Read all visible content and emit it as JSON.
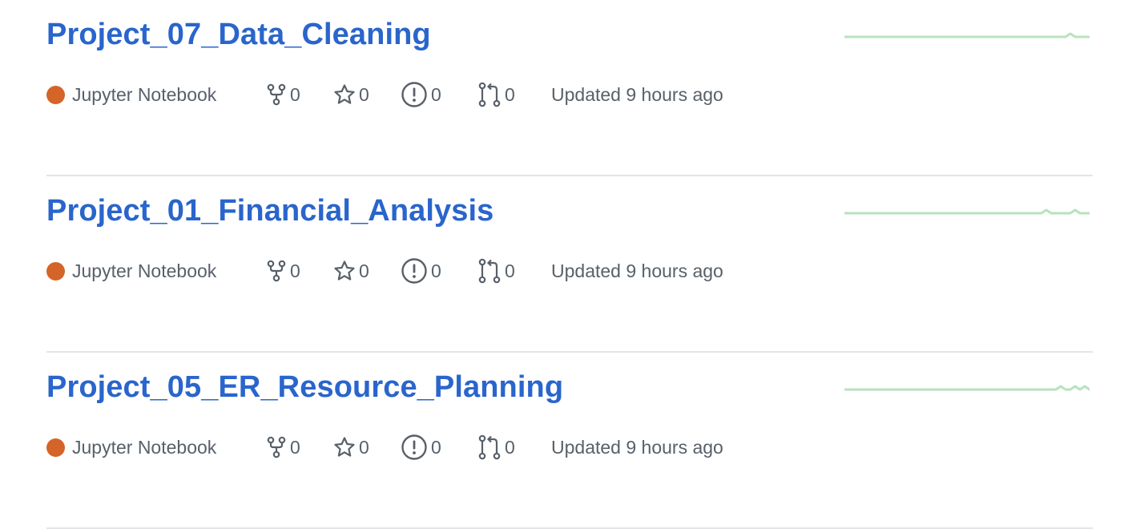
{
  "colors": {
    "title": "#2965cc",
    "meta_text": "#586069",
    "divider": "#e1e4e8",
    "sparkline": "#b7e3bd"
  },
  "repos": [
    {
      "name": "Project_07_Data_Cleaning",
      "language": "Jupyter Notebook",
      "language_color": "#d46428",
      "forks": "0",
      "stars": "0",
      "issues": "0",
      "pull_requests": "0",
      "updated": "Updated 9 hours ago",
      "activity": [
        0,
        0,
        0,
        0,
        0,
        0,
        0,
        0,
        0,
        0,
        0,
        0,
        0,
        0,
        0,
        0,
        0,
        0,
        0,
        0,
        0,
        0,
        0,
        0,
        0,
        0,
        0,
        0,
        0,
        0,
        0,
        0,
        0,
        0,
        0,
        0,
        0,
        0,
        0,
        0,
        0,
        0,
        0,
        0,
        0,
        0,
        0,
        1,
        0,
        0,
        0,
        0
      ]
    },
    {
      "name": "Project_01_Financial_Analysis",
      "language": "Jupyter Notebook",
      "language_color": "#d46428",
      "forks": "0",
      "stars": "0",
      "issues": "0",
      "pull_requests": "0",
      "updated": "Updated 9 hours ago",
      "activity": [
        0,
        0,
        0,
        0,
        0,
        0,
        0,
        0,
        0,
        0,
        0,
        0,
        0,
        0,
        0,
        0,
        0,
        0,
        0,
        0,
        0,
        0,
        0,
        0,
        0,
        0,
        0,
        0,
        0,
        0,
        0,
        0,
        0,
        0,
        0,
        0,
        0,
        0,
        0,
        0,
        0,
        0,
        1,
        0,
        0,
        0,
        0,
        0,
        1,
        0,
        0,
        0
      ]
    },
    {
      "name": "Project_05_ER_Resource_Planning",
      "language": "Jupyter Notebook",
      "language_color": "#d46428",
      "forks": "0",
      "stars": "0",
      "issues": "0",
      "pull_requests": "0",
      "updated": "Updated 9 hours ago",
      "activity": [
        0,
        0,
        0,
        0,
        0,
        0,
        0,
        0,
        0,
        0,
        0,
        0,
        0,
        0,
        0,
        0,
        0,
        0,
        0,
        0,
        0,
        0,
        0,
        0,
        0,
        0,
        0,
        0,
        0,
        0,
        0,
        0,
        0,
        0,
        0,
        0,
        0,
        0,
        0,
        0,
        0,
        0,
        0,
        0,
        0,
        1,
        0,
        0,
        1,
        0,
        1,
        0
      ]
    }
  ]
}
